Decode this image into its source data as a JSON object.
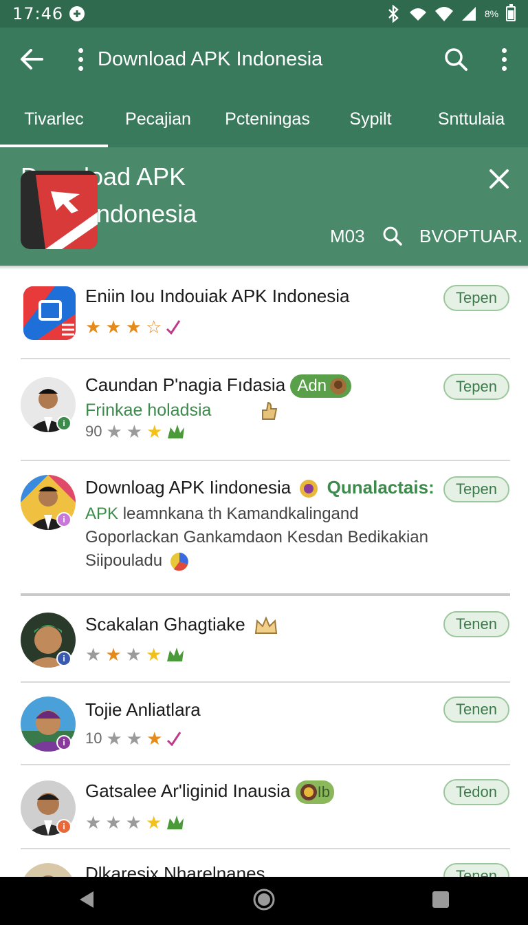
{
  "status_bar": {
    "time": "17:46",
    "battery_text": "8%"
  },
  "app_bar": {
    "title": "Download APK Indonesia"
  },
  "tabs": [
    {
      "label": "Tivarlec",
      "active": true
    },
    {
      "label": "Pecajian",
      "active": false
    },
    {
      "label": "Pcteningas",
      "active": false
    },
    {
      "label": "Sypilt",
      "active": false
    },
    {
      "label": "Snttulaia",
      "active": false
    }
  ],
  "banner": {
    "title_line1": "Download APK",
    "title_line2_prefix": "AP",
    "title_line2_suffix": "ndonesia",
    "code": "M03",
    "popular": "BVOPTUAR."
  },
  "items": [
    {
      "name": "Eniin Iou Indouiak APK Indonesia",
      "rating_prefix": "",
      "button": "Tepen"
    },
    {
      "name": "Caundan P'nagia Fıdasia",
      "badge": "Adn",
      "sub": "Frinkae holadsia",
      "rating_prefix": "90",
      "button": "Tepen"
    },
    {
      "name": "Downloag APK  Iindonesia",
      "tag": "Qunalactais:",
      "desc_green": "APK",
      "desc_line1": " leamnkana th Kamandkalingand",
      "desc_line2": "Goporlackan Gankamdaon Kesdan Bedikakian",
      "desc_line3": "Siipouladu",
      "button": "Tepen"
    },
    {
      "name": "Scakalan Ghagtiake",
      "rating_prefix": "",
      "button": "Tenen"
    },
    {
      "name": "Tojie  Anliatlara",
      "rating_prefix": "10",
      "button": "Tenen"
    },
    {
      "name": "Gatsalee Ar'liginid Inausia",
      "badge": "Ib",
      "rating_prefix": "",
      "button": "Tedon"
    },
    {
      "name": "Dlkaresix Nharelnanes",
      "button": "Tenen"
    }
  ],
  "colors": {
    "status_bar": "#2f6a4f",
    "app_bar": "#3a7a5c",
    "banner": "#4a8a6a",
    "accent_green": "#3c8a4c",
    "star_orange": "#e68a1a"
  }
}
